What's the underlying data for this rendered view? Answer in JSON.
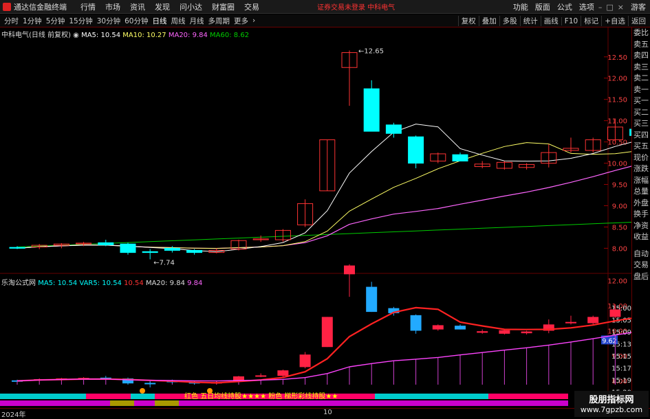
{
  "app": {
    "name": "通达信金融终端",
    "warning": "证券交易未登录 中科电气",
    "menu": [
      "行情",
      "市场",
      "资讯",
      "发现",
      "问小达",
      "财富圈",
      "交易"
    ],
    "right_menu": [
      "功能",
      "版面",
      "公式",
      "选项",
      "游客"
    ]
  },
  "toolbar": {
    "periods": [
      "分时",
      "1分钟",
      "5分钟",
      "15分钟",
      "30分钟",
      "60分钟",
      "日线",
      "周线",
      "月线",
      "多周期",
      "更多"
    ],
    "active": "日线",
    "right": [
      "复权",
      "叠加",
      "多股",
      "统计",
      "画线",
      "F10",
      "标记",
      "+自选",
      "返回"
    ]
  },
  "sidebar": [
    "委比",
    "卖五",
    "卖四",
    "卖三",
    "卖二",
    "卖一",
    "买一",
    "买二",
    "买三",
    "买四",
    "买五",
    "现价",
    "涨跌",
    "涨幅",
    "总量",
    "外盘",
    "换手",
    "净资",
    "收益",
    "",
    "自动",
    "交易",
    "盘后"
  ],
  "legend1": {
    "name": "中科电气(日线 前复权)",
    "ma5": "MA5: 10.54",
    "ma10": "MA10: 10.27",
    "ma20": "MA20: 9.84",
    "ma60": "MA60: 8.62"
  },
  "legend2": {
    "name": "乐淘公式网",
    "ma5": "MA5: 10.54",
    "var5": "VAR5: 10.54",
    "v3": "10.54",
    "ma20": "MA20: 9.84",
    "v4": "9.84"
  },
  "annot": {
    "high": "12.65",
    "low": "7.74"
  },
  "axis1": [
    "12.50",
    "12.00",
    "11.50",
    "11.00",
    "10.50",
    "10.00",
    "9.50",
    "9.00",
    "8.50",
    "8.00"
  ],
  "axis2": [
    "12.00",
    "11.00",
    "10.00",
    "9.00",
    "8.00"
  ],
  "times": [
    "15:00",
    "15:05",
    "15:09",
    "15:13",
    "15:15",
    "15:17",
    "15:19",
    "15:20"
  ],
  "price_tag": "9.62",
  "banner": "红色 五日均线持股★★★★ 粉色 梯形彩线持股★★",
  "date_start": "2024年",
  "date_mark": "10",
  "watermark": {
    "line1": "股朋指标网",
    "line2": "www.7gpzb.com"
  },
  "colors": {
    "up": "#ff3333",
    "down": "#00ffff",
    "ma5": "#ffffff",
    "ma10": "#ffff66",
    "ma20": "#ff66ff",
    "ma60": "#00cc00"
  },
  "chart_data": {
    "type": "candlestick",
    "candles": [
      {
        "o": 8.02,
        "h": 8.05,
        "l": 7.98,
        "c": 8.0
      },
      {
        "o": 8.03,
        "h": 8.1,
        "l": 7.98,
        "c": 8.07
      },
      {
        "o": 8.07,
        "h": 8.12,
        "l": 8.0,
        "c": 8.1
      },
      {
        "o": 8.1,
        "h": 8.15,
        "l": 8.05,
        "c": 8.12
      },
      {
        "o": 8.13,
        "h": 8.2,
        "l": 8.05,
        "c": 8.08
      },
      {
        "o": 8.1,
        "h": 8.13,
        "l": 7.85,
        "c": 7.9
      },
      {
        "o": 7.92,
        "h": 7.98,
        "l": 7.74,
        "c": 7.9
      },
      {
        "o": 8.0,
        "h": 8.05,
        "l": 7.9,
        "c": 7.95
      },
      {
        "o": 7.95,
        "h": 7.98,
        "l": 7.85,
        "c": 7.9
      },
      {
        "o": 7.9,
        "h": 8.0,
        "l": 7.88,
        "c": 7.95
      },
      {
        "o": 7.98,
        "h": 8.2,
        "l": 7.95,
        "c": 8.18
      },
      {
        "o": 8.2,
        "h": 8.3,
        "l": 8.15,
        "c": 8.22
      },
      {
        "o": 8.2,
        "h": 8.45,
        "l": 8.15,
        "c": 8.42
      },
      {
        "o": 8.55,
        "h": 9.15,
        "l": 8.5,
        "c": 9.05
      },
      {
        "o": 9.35,
        "h": 10.55,
        "l": 9.35,
        "c": 10.55
      },
      {
        "o": 12.25,
        "h": 12.65,
        "l": 11.35,
        "c": 12.6
      },
      {
        "o": 11.75,
        "h": 11.95,
        "l": 10.75,
        "c": 10.75
      },
      {
        "o": 10.9,
        "h": 10.95,
        "l": 10.6,
        "c": 10.7
      },
      {
        "o": 10.62,
        "h": 10.65,
        "l": 9.88,
        "c": 10.0
      },
      {
        "o": 10.05,
        "h": 10.25,
        "l": 10.0,
        "c": 10.22
      },
      {
        "o": 10.2,
        "h": 10.25,
        "l": 10.05,
        "c": 10.05
      },
      {
        "o": 9.92,
        "h": 10.05,
        "l": 9.88,
        "c": 9.98
      },
      {
        "o": 9.88,
        "h": 10.05,
        "l": 9.85,
        "c": 10.02
      },
      {
        "o": 9.9,
        "h": 10.0,
        "l": 9.85,
        "c": 9.97
      },
      {
        "o": 10.0,
        "h": 10.45,
        "l": 9.9,
        "c": 10.25
      },
      {
        "o": 10.3,
        "h": 10.6,
        "l": 10.25,
        "c": 10.35
      },
      {
        "o": 10.3,
        "h": 10.6,
        "l": 10.25,
        "c": 10.55
      },
      {
        "o": 10.55,
        "h": 11.05,
        "l": 10.5,
        "c": 10.85
      },
      {
        "o": 10.8,
        "h": 10.82,
        "l": 10.6,
        "c": 10.65
      }
    ]
  }
}
